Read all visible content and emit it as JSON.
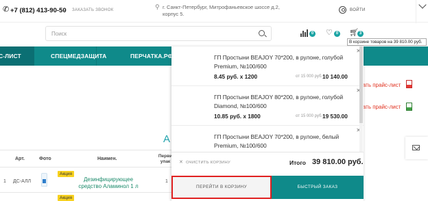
{
  "header": {
    "phone": "+7 (812) 413-90-50",
    "callback_label": "ЗАКАЗАТЬ ЗВОНОК",
    "address": "г. Санкт-Петербург, Митрофаньевское шоссе д.2, корпус 5.",
    "login_label": "ВОЙТИ"
  },
  "search": {
    "placeholder": "Поиск"
  },
  "header_icons": {
    "compare_count": "0",
    "favorites_count": "0",
    "cart_count": "3",
    "cart_tooltip": "В корзине товаров на 39 810.00 руб."
  },
  "nav": {
    "items": [
      {
        "label": "С-ЛИСТ"
      },
      {
        "label": "СПЕЦМЕДЗАЩИТА"
      },
      {
        "label": "ПЕРЧАТКА.РФ"
      }
    ]
  },
  "page": {
    "title_fragment": "А",
    "download_pdf": "Скачать прайс-лист",
    "download_xls": "Скачать прайс-лист"
  },
  "table": {
    "headers": {
      "art": "Арт.",
      "photo": "Фото",
      "name": "Наимен.",
      "pack": "Перви упак"
    },
    "rows": [
      {
        "num": "1",
        "art": "ДС-АЛЛ",
        "badge": "Акция",
        "name": "Дезинфицирующее средство Аламинол 1 л",
        "pack": "1"
      },
      {
        "badge": "Акция"
      }
    ]
  },
  "cart": {
    "items": [
      {
        "name": "ГП Простыни BEAJOY 70*200, в рулоне, голубой Premium, №100/600",
        "qty_line": "8.45 руб. x 1200",
        "from_label": "от 15 000 руб.",
        "total": "10 140.00"
      },
      {
        "name": "ГП Простыни BEAJOY 80*200, в рулоне, голубой Diamond, №100/600",
        "qty_line": "10.85 руб. x 1800",
        "from_label": "от 15 000 руб.",
        "total": "19 530.00"
      },
      {
        "name": "ГП Простыни BEAJOY 70*200, в рулоне, белый Premium, №100/600",
        "qty_line": "",
        "from_label": "",
        "total": ""
      }
    ],
    "clear_label": "ОЧИСТИТЬ КОРЗИНУ",
    "total_label": "Итого",
    "total_value": "39 810.00 руб.",
    "go_to_cart_label": "ПЕРЕЙТИ В КОРЗИНУ",
    "quick_order_label": "БЫСТРЫЙ ЗАКАЗ"
  }
}
